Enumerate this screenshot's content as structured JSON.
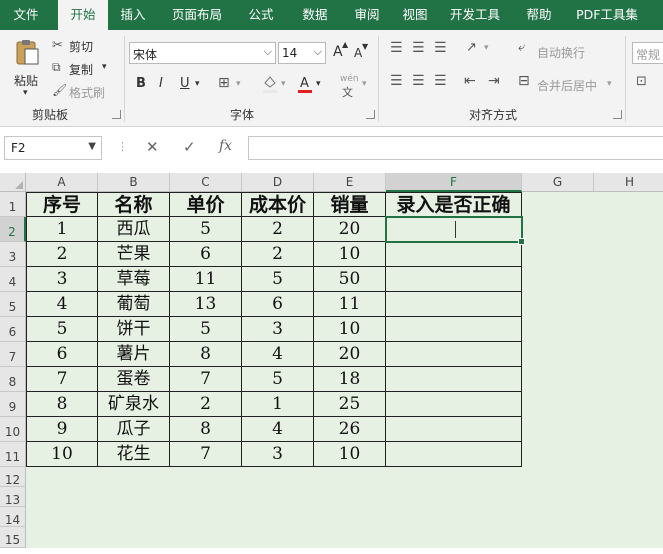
{
  "tabs": [
    "文件",
    "开始",
    "插入",
    "页面布局",
    "公式",
    "数据",
    "审阅",
    "视图",
    "开发工具",
    "帮助",
    "PDF工具集"
  ],
  "active_tab": "开始",
  "ribbon": {
    "clipboard": {
      "paste": "粘贴",
      "cut": "剪切",
      "copy": "复制",
      "format_painter": "格式刷",
      "label": "剪贴板"
    },
    "font": {
      "name": "宋体",
      "size": "14",
      "bold": "B",
      "italic": "I",
      "underline": "U",
      "label": "字体",
      "grow": "A",
      "shrink": "A",
      "phonetic": "wén"
    },
    "alignment": {
      "wrap": "自动换行",
      "merge": "合并后居中",
      "label": "对齐方式"
    },
    "number": {
      "format": "常规"
    }
  },
  "formula_bar": {
    "name_box": "F2",
    "cancel": "✕",
    "enter": "✓",
    "fx": "fx",
    "value": ""
  },
  "columns": [
    "A",
    "B",
    "C",
    "D",
    "E",
    "F",
    "G",
    "H"
  ],
  "rows": [
    "1",
    "2",
    "3",
    "4",
    "5",
    "6",
    "7",
    "8",
    "9",
    "10",
    "11",
    "12",
    "13",
    "14",
    "15"
  ],
  "table": {
    "headers": [
      "序号",
      "名称",
      "单价",
      "成本价",
      "销量",
      "录入是否正确"
    ],
    "rows": [
      [
        "1",
        "西瓜",
        "5",
        "2",
        "20",
        ""
      ],
      [
        "2",
        "芒果",
        "6",
        "2",
        "10",
        ""
      ],
      [
        "3",
        "草莓",
        "11",
        "5",
        "50",
        ""
      ],
      [
        "4",
        "葡萄",
        "13",
        "6",
        "11",
        ""
      ],
      [
        "5",
        "饼干",
        "5",
        "3",
        "10",
        ""
      ],
      [
        "6",
        "薯片",
        "8",
        "4",
        "20",
        ""
      ],
      [
        "7",
        "蛋卷",
        "7",
        "5",
        "18",
        ""
      ],
      [
        "8",
        "矿泉水",
        "2",
        "1",
        "25",
        ""
      ],
      [
        "9",
        "瓜子",
        "8",
        "4",
        "26",
        ""
      ],
      [
        "10",
        "花生",
        "7",
        "3",
        "10",
        ""
      ]
    ]
  },
  "selected_cell": "F2",
  "colors": {
    "accent": "#217346",
    "sheet_bg": "#e7f1e3"
  }
}
